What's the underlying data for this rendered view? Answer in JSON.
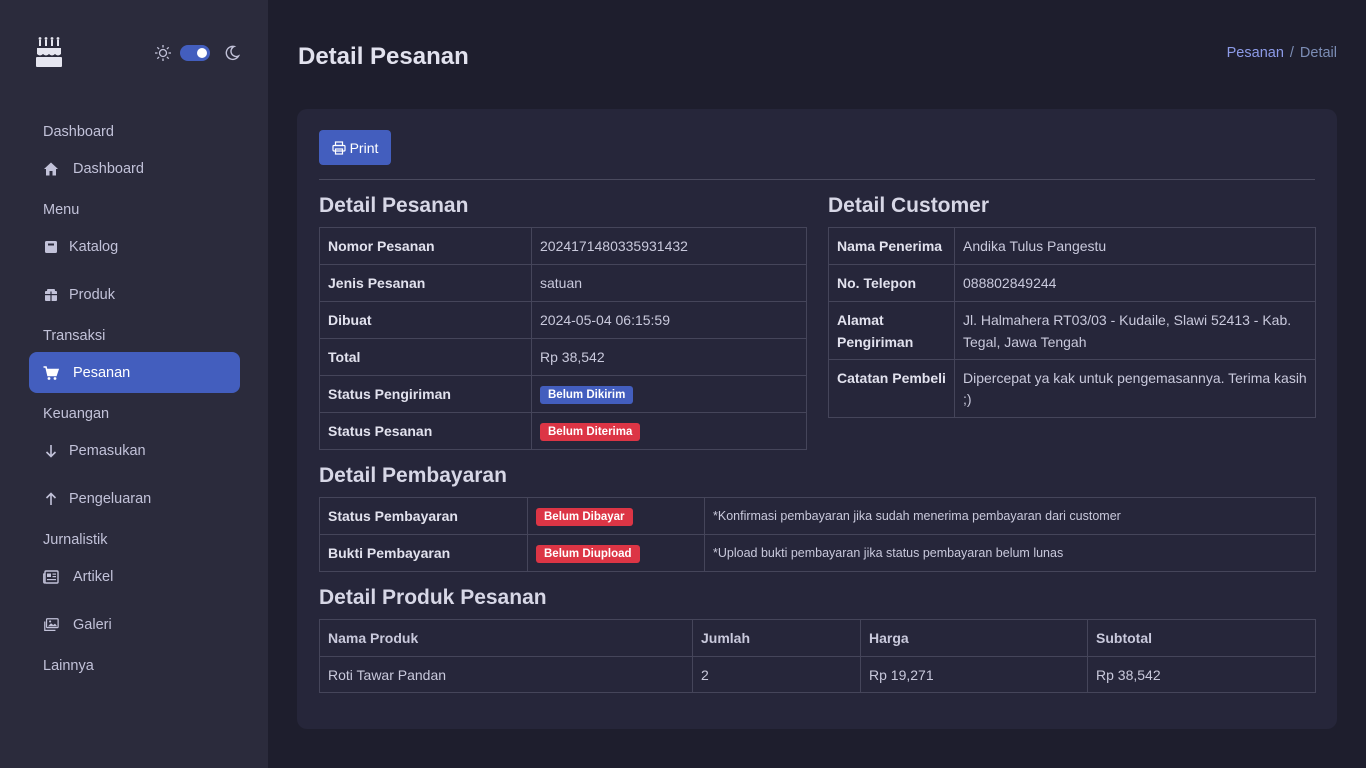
{
  "theme": {
    "accent": "#435ebe",
    "danger": "#dc3545",
    "bg": "#1e1e2d",
    "sidebar_bg": "#2b2b3c",
    "card_bg": "#26263a"
  },
  "sidebar": {
    "logo_icon": "cake-icon",
    "sections": [
      {
        "title": "Dashboard",
        "items": [
          {
            "label": "Dashboard",
            "icon": "house-icon"
          }
        ]
      },
      {
        "title": "Menu",
        "items": [
          {
            "label": "Katalog",
            "icon": "book-icon"
          },
          {
            "label": "Produk",
            "icon": "box-icon"
          }
        ]
      },
      {
        "title": "Transaksi",
        "items": [
          {
            "label": "Pesanan",
            "icon": "cart-icon",
            "active": true
          }
        ]
      },
      {
        "title": "Keuangan",
        "items": [
          {
            "label": "Pemasukan",
            "icon": "arrow-down-icon"
          },
          {
            "label": "Pengeluaran",
            "icon": "arrow-up-icon"
          }
        ]
      },
      {
        "title": "Jurnalistik",
        "items": [
          {
            "label": "Artikel",
            "icon": "newspaper-icon"
          },
          {
            "label": "Galeri",
            "icon": "images-icon"
          }
        ]
      },
      {
        "title": "Lainnya",
        "items": []
      }
    ]
  },
  "header": {
    "title": "Detail Pesanan",
    "breadcrumb": {
      "parent": "Pesanan",
      "separator": "/",
      "current": "Detail"
    }
  },
  "toolbar": {
    "print_label": "Print"
  },
  "order": {
    "title": "Detail Pesanan",
    "rows": [
      {
        "label": "Nomor Pesanan",
        "value": "2024171480335931432"
      },
      {
        "label": "Jenis Pesanan",
        "value": "satuan"
      },
      {
        "label": "Dibuat",
        "value": "2024-05-04 06:15:59"
      },
      {
        "label": "Total",
        "value": "Rp 38,542"
      },
      {
        "label": "Status Pengiriman",
        "badge": "Belum Dikirim"
      },
      {
        "label": "Status Pesanan",
        "badge": "Belum Diterima"
      }
    ]
  },
  "customer": {
    "title": "Detail Customer",
    "rows": [
      {
        "label": "Nama Penerima",
        "value": "Andika Tulus Pangestu"
      },
      {
        "label": "No. Telepon",
        "value": "088802849244"
      },
      {
        "label": "Alamat Pengiriman",
        "value": "Jl. Halmahera RT03/03 - Kudaile, Slawi 52413 - Kab. Tegal, Jawa Tengah"
      },
      {
        "label": "Catatan Pembeli",
        "value": "Dipercepat ya kak untuk pengemasannya. Terima kasih ;)"
      }
    ]
  },
  "payment": {
    "title": "Detail Pembayaran",
    "rows": [
      {
        "label": "Status Pembayaran",
        "badge": "Belum Dibayar",
        "note": "*Konfirmasi pembayaran jika sudah menerima pembayaran dari customer"
      },
      {
        "label": "Bukti Pembayaran",
        "badge": "Belum Diupload",
        "note": "*Upload bukti pembayaran jika status pembayaran belum lunas"
      }
    ]
  },
  "products": {
    "title": "Detail Produk Pesanan",
    "columns": [
      "Nama Produk",
      "Jumlah",
      "Harga",
      "Subtotal"
    ],
    "rows": [
      [
        "Roti Tawar Pandan",
        "2",
        "Rp 19,271",
        "Rp 38,542"
      ]
    ]
  }
}
